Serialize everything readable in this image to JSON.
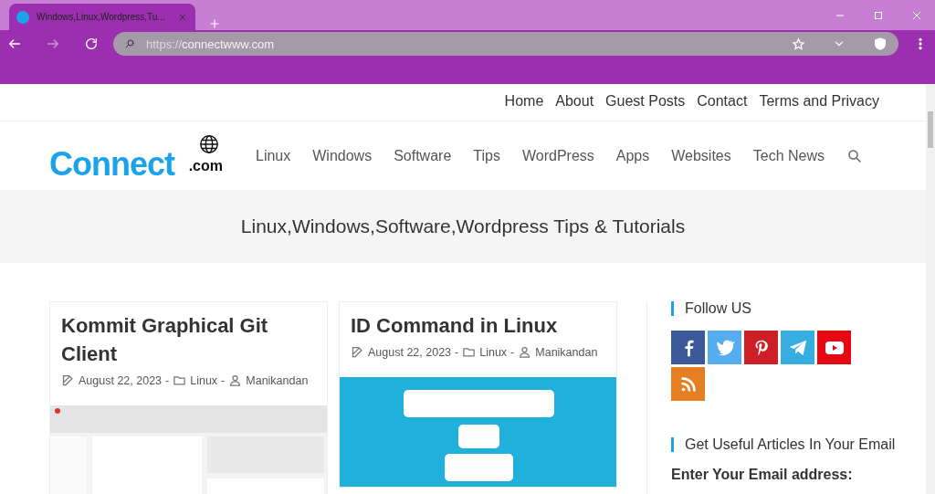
{
  "browser": {
    "tab": {
      "title": "Windows,Linux,Wordpress,Tu...",
      "selected": true
    },
    "url_scheme": "https://",
    "url_host": "connectwww.com"
  },
  "top_menu": [
    "Home",
    "About",
    "Guest Posts",
    "Contact",
    "Terms and Privacy"
  ],
  "logo": {
    "word": "Connect",
    "suffix": ".com"
  },
  "main_menu": [
    "Linux",
    "Windows",
    "Software",
    "Tips",
    "WordPress",
    "Apps",
    "Websites",
    "Tech News"
  ],
  "tagline": "Linux,Windows,Software,Wordpress Tips & Tutorials",
  "posts": [
    {
      "title": "Kommit Graphical Git Client",
      "date": "August 22, 2023",
      "category": "Linux",
      "author": "Manikandan",
      "separator": "-"
    },
    {
      "title": "ID Command in Linux",
      "date": "August 22, 2023",
      "category": "Linux",
      "author": "Manikandan",
      "separator": "-"
    }
  ],
  "sidebar": {
    "follow_title": "Follow US",
    "social": [
      {
        "kind": "facebook",
        "color": "#3b5998"
      },
      {
        "kind": "twitter",
        "color": "#55acee"
      },
      {
        "kind": "pinterest",
        "color": "#cb2027"
      },
      {
        "kind": "telegram",
        "color": "#37aee2"
      },
      {
        "kind": "youtube",
        "color": "#e50914"
      },
      {
        "kind": "rss",
        "color": "#e67e22"
      }
    ],
    "newsletter_title": "Get Useful Articles In Your Email",
    "email_label": "Enter Your Email address:"
  }
}
